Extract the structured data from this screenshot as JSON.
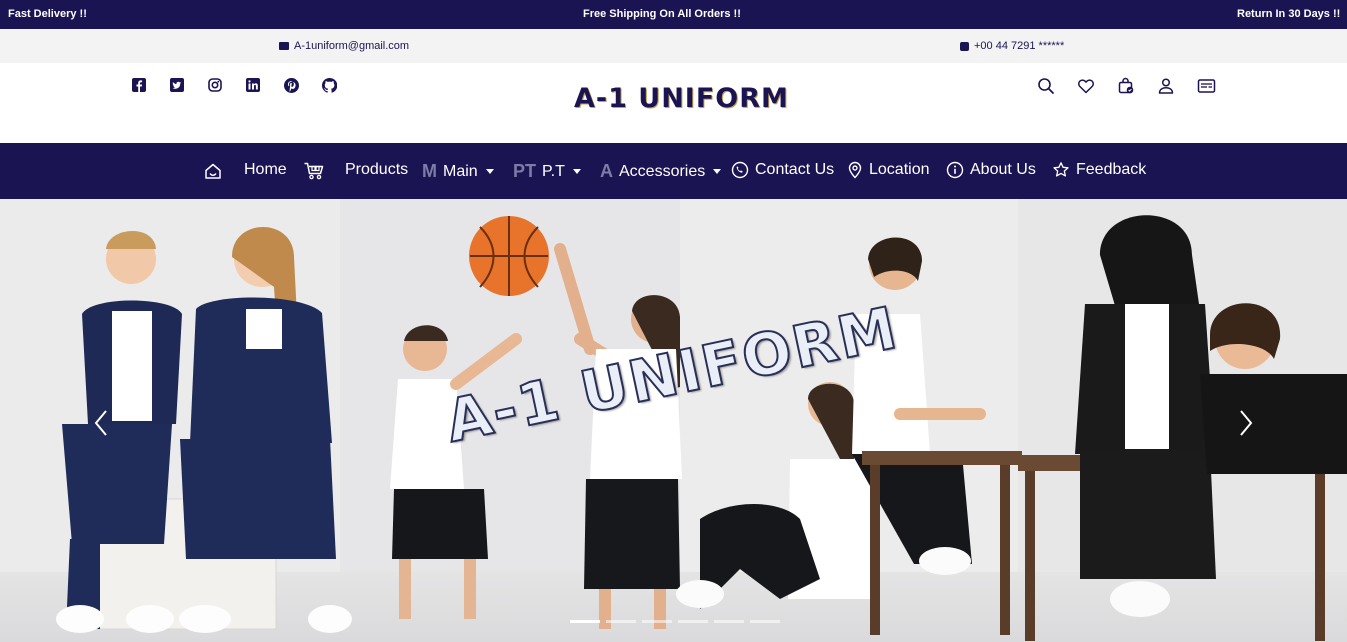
{
  "topbar": {
    "left": "Fast Delivery !!",
    "center": "Free Shipping On All Orders !!",
    "right": "Return In 30 Days !!"
  },
  "contact": {
    "email": "A-1uniform@gmail.com",
    "phone": "+00 44 7291 ******",
    "email_icon": "envelope-icon",
    "phone_icon": "phone-icon"
  },
  "header": {
    "brand": "A-1 UNIFORM",
    "social_icons": [
      "facebook-icon",
      "twitter-icon",
      "instagram-icon",
      "linkedin-icon",
      "pinterest-icon",
      "github-icon"
    ],
    "tool_icons": [
      "search-icon",
      "heart-icon",
      "cart-icon",
      "user-icon",
      "card-icon"
    ]
  },
  "nav": {
    "home": "Home",
    "products": "Products",
    "main_glyph": "M",
    "main": "Main",
    "pt_glyph": "PT",
    "pt": "P.T",
    "acc_glyph": "A",
    "accessories": "Accessories",
    "contact": "Contact Us",
    "location": "Location",
    "about": "About Us",
    "feedback": "Feedback"
  },
  "hero": {
    "overlay_text": "A-1 UNIFORM",
    "slides": 6,
    "active_slide": 1
  },
  "colors": {
    "navy": "#1b1452",
    "accent": "#c9a14a"
  }
}
